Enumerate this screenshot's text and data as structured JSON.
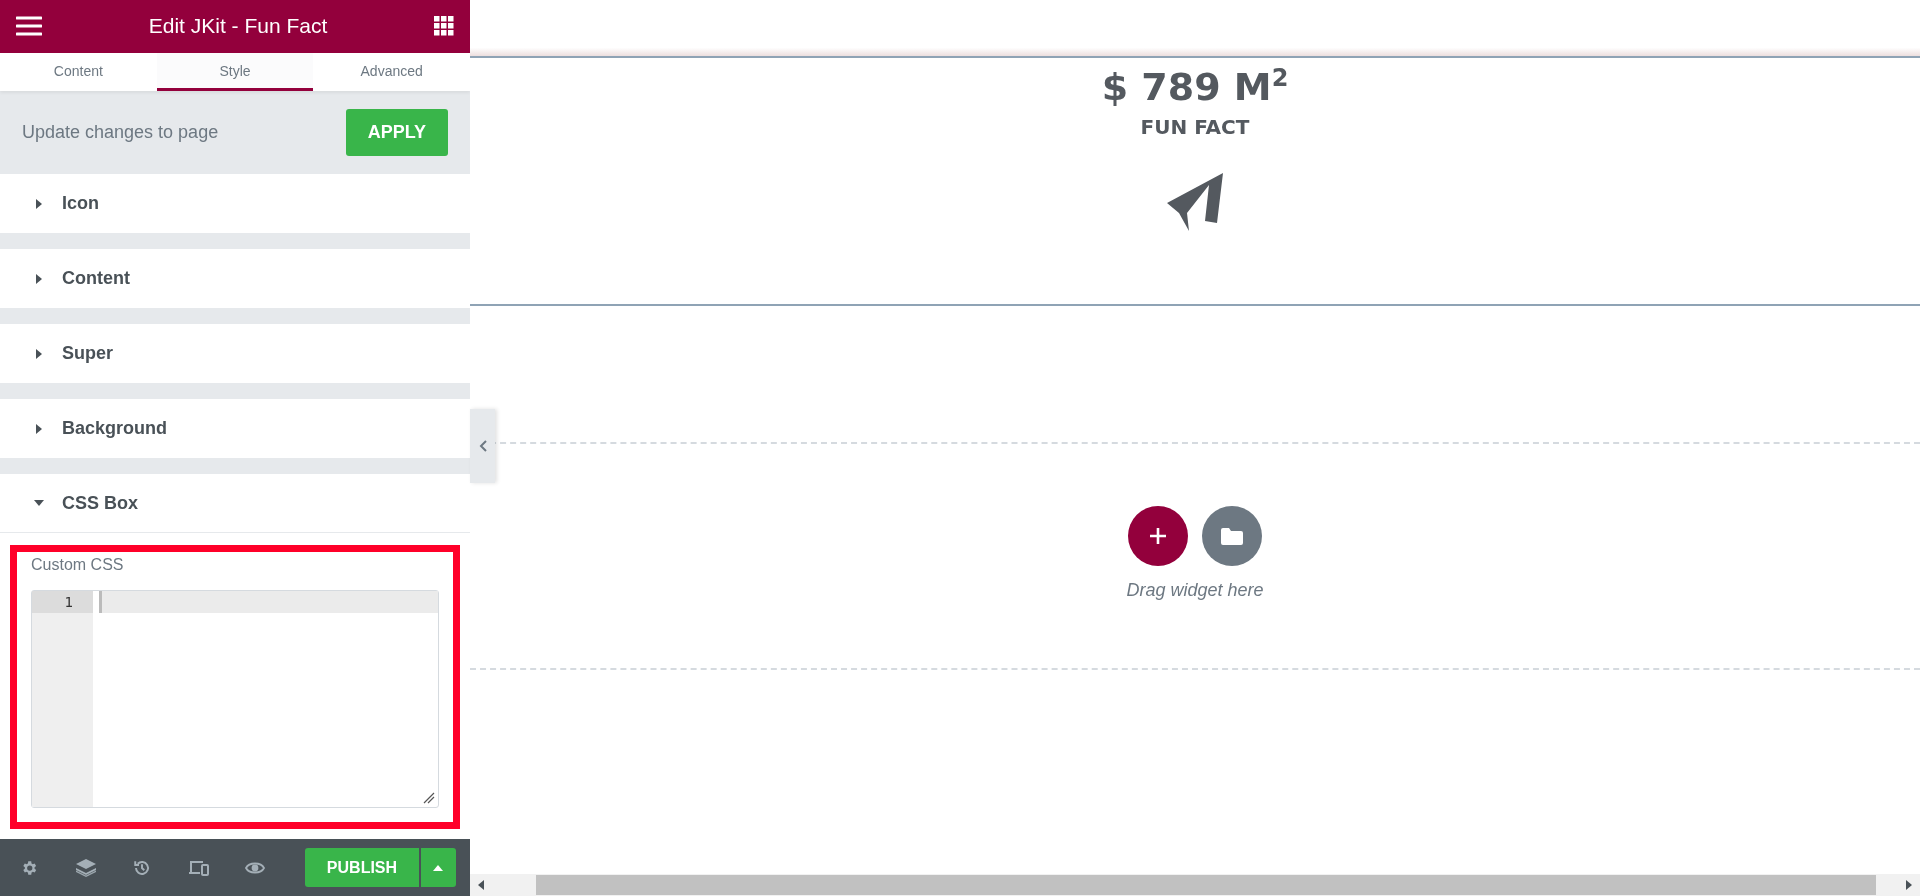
{
  "panel": {
    "title": "Edit JKit - Fun Fact",
    "tabs": [
      {
        "label": "Content",
        "selected": false
      },
      {
        "label": "Style",
        "selected": true
      },
      {
        "label": "Advanced",
        "selected": false
      }
    ],
    "update_bar": {
      "text": "Update changes to page",
      "button": "APPLY"
    },
    "sections": [
      {
        "label": "Icon",
        "expanded": false
      },
      {
        "label": "Content",
        "expanded": false
      },
      {
        "label": "Super",
        "expanded": false
      },
      {
        "label": "Background",
        "expanded": false
      },
      {
        "label": "CSS Box",
        "expanded": true,
        "field": {
          "label": "Custom CSS",
          "highlighted": true,
          "line_numbers": [
            "1"
          ]
        }
      }
    ],
    "footer": {
      "publish": "PUBLISH"
    }
  },
  "canvas": {
    "fun_fact": {
      "value": "$ 789 M$^{2}$",
      "title": "FUN FACT"
    },
    "drop_zone": {
      "hint": "Drag widget here"
    }
  }
}
